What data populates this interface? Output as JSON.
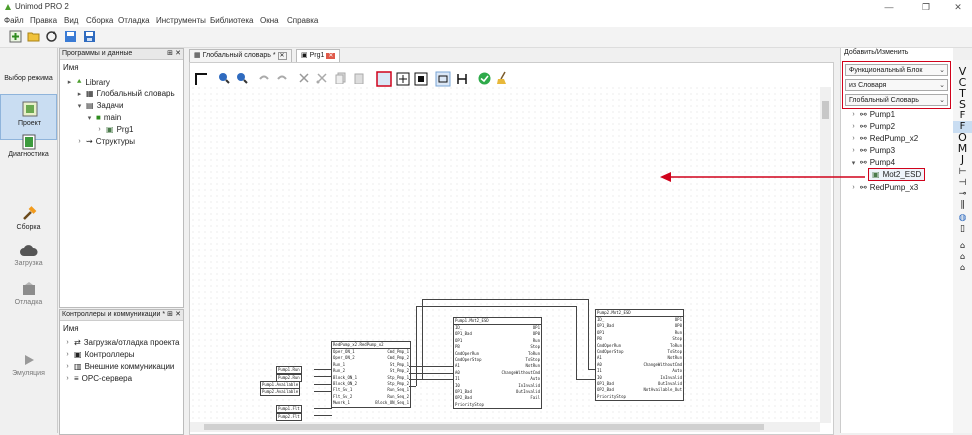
{
  "window": {
    "title": "Unimod PRO 2",
    "minimize": "—",
    "maximize": "❐",
    "close": "✕"
  },
  "menu": [
    "Файл",
    "Правка",
    "Вид",
    "Сборка",
    "Отладка",
    "Инструменты",
    "Библиотека",
    "Окна",
    "Справка"
  ],
  "modes": {
    "header": "Выбор режима",
    "items": [
      {
        "label": "Проект",
        "active": true
      },
      {
        "label": "Диагностика",
        "active": false
      },
      {
        "label": "Сборка",
        "active": false
      },
      {
        "label": "Загрузка",
        "active": false
      },
      {
        "label": "Отладка",
        "active": false
      },
      {
        "label": "Эмуляция",
        "active": false
      }
    ]
  },
  "programs_panel": {
    "title": "Программы и данные",
    "column": "Имя",
    "tree": {
      "library": "Library",
      "global_dict": "Глобальный словарь",
      "tasks": "Задачи",
      "main": "main",
      "prg1": "Prg1",
      "structures": "Структуры"
    }
  },
  "controllers_panel": {
    "title": "Контроллеры и коммуникации *",
    "column": "Имя",
    "items": [
      "Загрузка/отладка проекта",
      "Контроллеры",
      "Внешние коммуникации",
      "OPC-сервера"
    ]
  },
  "tabs": [
    {
      "label": "Глобальный словарь *",
      "active": false
    },
    {
      "label": "Prg1",
      "active": true
    }
  ],
  "right_panel": {
    "title": "Добавить/Изменить",
    "combo1": "Функциональный Блок",
    "combo2": "из Словаря",
    "combo3": "Глобальный Словарь",
    "items": [
      "Pump1",
      "Pump2",
      "RedPump_x2",
      "Pump3",
      "Pump4",
      "Mot2_ESD",
      "RedPump_x3"
    ]
  },
  "side_symbols": [
    "V",
    "C",
    "T",
    "S",
    "F",
    "F",
    "O",
    "M",
    "J"
  ],
  "diagram": {
    "block_a": {
      "title": "RedPump_x2.RedPump_x2",
      "left": [
        "Oper_ON_1",
        "Oper_ON_2",
        "Run_1",
        "Run_2",
        "Block_ON_1",
        "Block_ON_2",
        "Flt_Sv_1",
        "Flt_Sv_2",
        "Mwork_1"
      ],
      "right": [
        "Cmd_Pmp_1",
        "Cmd_Pmp_2",
        "St_Pmp_1",
        "St_Pmp_2",
        "Stp_Pmp_1",
        "Stp_Pmp_2",
        "Run_Seq_1",
        "Run_Seq_2",
        "Block_ON_Seq_1"
      ]
    },
    "block_b": {
      "title": "Pump1.Mot2_ESD",
      "left": [
        "ID_",
        "OP1_Bad",
        "OP1",
        "PB",
        "CmdOperRun",
        "CmdOperStop",
        "A1",
        "A0",
        "I1",
        "I0",
        "OP1_Bad",
        "OP2_Bad",
        "PriorityStop"
      ],
      "right": [
        "OP1",
        "OP0",
        "Run",
        "Stop",
        "ToRun",
        "ToStop",
        "NotRun",
        "ChangeWithoutCmd",
        "Auto",
        "InInvalid",
        "OutInvalid",
        "Fail"
      ]
    },
    "block_c": {
      "title": "Pump2.Mot2_ESD",
      "left": [
        "ID_",
        "OP1_Bad",
        "OP1",
        "PB",
        "CmdOperRun",
        "CmdOperStop",
        "A1",
        "A0",
        "I1",
        "I0",
        "OP1_Bad",
        "OP2_Bad",
        "PriorityStop"
      ],
      "right": [
        "OP1",
        "OP0",
        "Run",
        "Stop",
        "ToRun",
        "ToStop",
        "NotRun",
        "ChangeWithoutCmd",
        "Auto",
        "InInvalid",
        "OutInvalid",
        "NotAvailable_Out"
      ]
    },
    "inputs": [
      "Pump1.Run",
      "Pump2.Run",
      "Pump1.Available",
      "Pump2.Available",
      "Pump1.Flt",
      "Pump2.Flt"
    ]
  },
  "colors": {
    "highlight": "#d0021b",
    "active_mode": "#c9ddf2"
  }
}
